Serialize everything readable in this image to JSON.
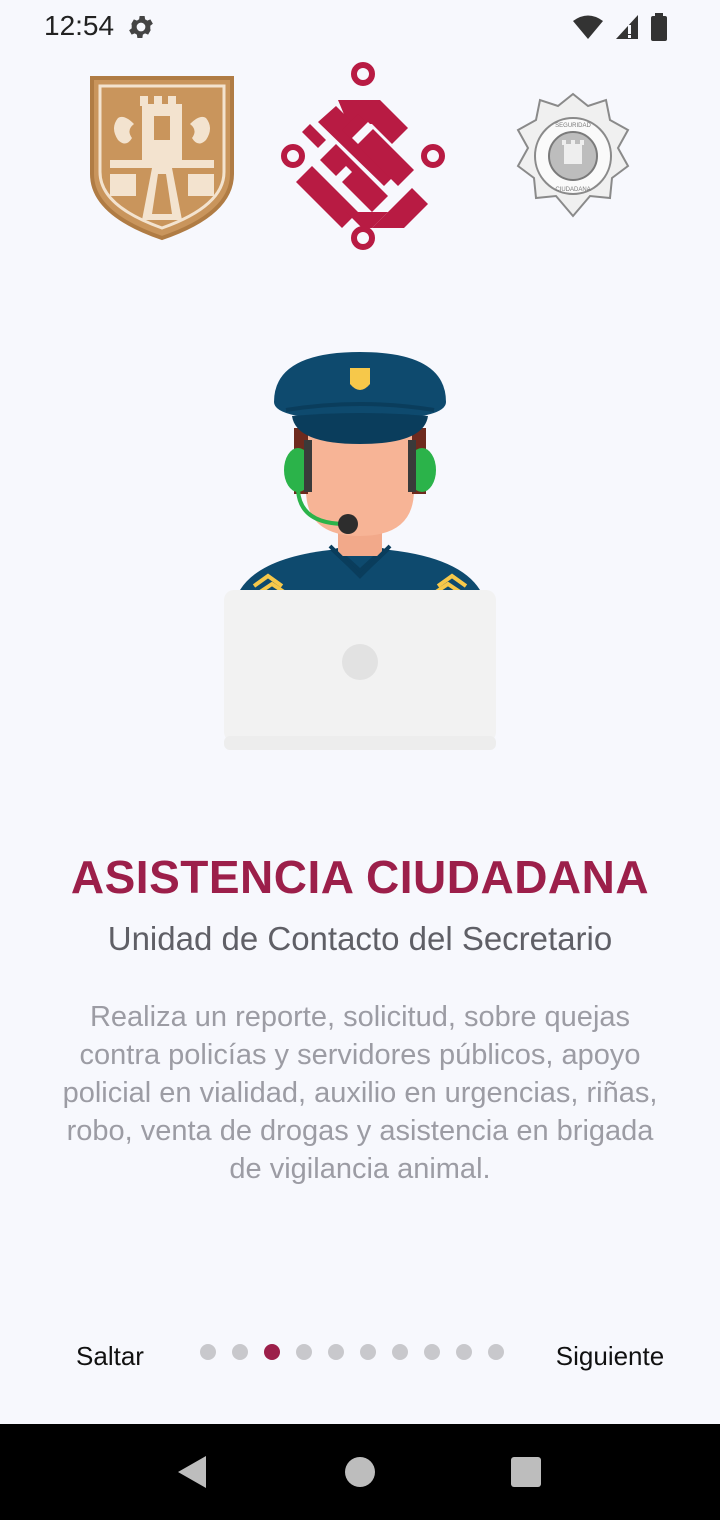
{
  "status_bar": {
    "time": "12:54",
    "icons": [
      "gear-icon",
      "wifi-icon",
      "cell-signal-icon",
      "battery-icon"
    ]
  },
  "header": {
    "logos": [
      "cdmx-coat-of-arms-logo",
      "cdmx-government-logo",
      "seguridad-ciudadana-badge-logo"
    ],
    "badge_text_top": "SEGURIDAD",
    "badge_text_bottom": "CIUDADANA"
  },
  "slide": {
    "illustration": "police-operator-with-headset-and-laptop",
    "title": "ASISTENCIA CIUDADANA",
    "subtitle": "Unidad de Contacto del Secretario",
    "description": "Realiza un reporte, solicitud, sobre quejas contra policías y servidores públicos, apoyo policial en vialidad, auxilio en urgencias, riñas, robo, venta de drogas y asistencia en brigada de vigilancia animal."
  },
  "pager": {
    "skip_label": "Saltar",
    "next_label": "Siguiente",
    "total_pages": 10,
    "current_page": 3
  },
  "colors": {
    "accent": "#9c1f4a",
    "background": "#f7f8fd",
    "dot_inactive": "#c8c8cc"
  },
  "nav_bar": {
    "icons": [
      "back-icon",
      "home-icon",
      "recents-icon"
    ]
  }
}
